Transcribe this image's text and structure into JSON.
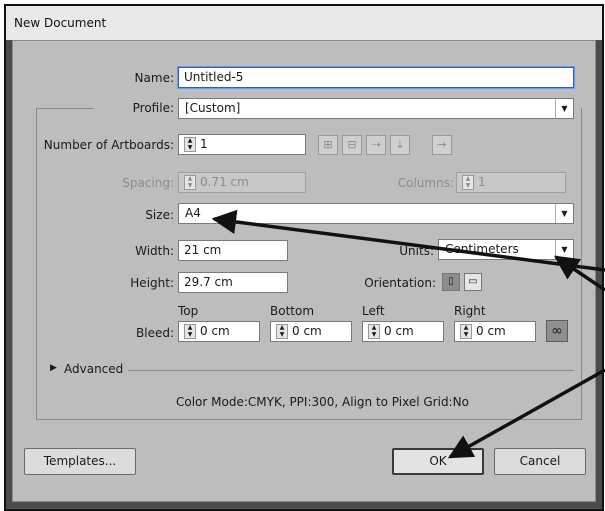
{
  "window": {
    "title": "New Document"
  },
  "form": {
    "name_label": "Name:",
    "name_value": "Untitled-5",
    "profile_label": "Profile:",
    "profile_value": "[Custom]",
    "artboards_label": "Number of Artboards:",
    "artboards_value": "1",
    "spacing_label": "Spacing:",
    "spacing_value": "0.71 cm",
    "columns_label": "Columns:",
    "columns_value": "1",
    "size_label": "Size:",
    "size_value": "A4",
    "width_label": "Width:",
    "width_value": "21 cm",
    "units_label": "Units:",
    "units_value": "Centimeters",
    "height_label": "Height:",
    "height_value": "29.7 cm",
    "orientation_label": "Orientation:",
    "bleed_label": "Bleed:",
    "bleed": {
      "top_label": "Top",
      "top_value": "0 cm",
      "bottom_label": "Bottom",
      "bottom_value": "0 cm",
      "left_label": "Left",
      "left_value": "0 cm",
      "right_label": "Right",
      "right_value": "0 cm"
    },
    "advanced_label": "Advanced",
    "info_text": "Color Mode:CMYK, PPI:300, Align to Pixel Grid:No"
  },
  "buttons": {
    "templates": "Templates...",
    "ok": "OK",
    "cancel": "Cancel"
  },
  "icons": {
    "stepper": "stepper-icon",
    "dropdown": "chevron-down-icon",
    "link": "link-chain-icon",
    "advanced": "triangle-right-icon"
  }
}
